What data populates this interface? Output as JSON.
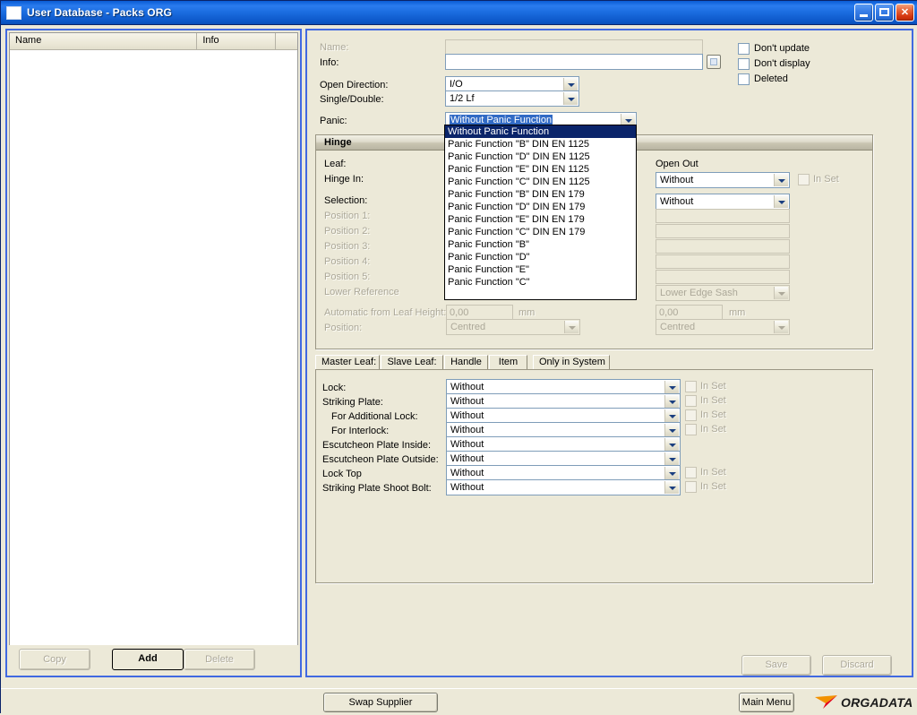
{
  "window": {
    "title": "User Database - Packs ORG",
    "buttons": {
      "minimize": "minimize",
      "maximize": "maximize",
      "close": "close"
    }
  },
  "left_panel": {
    "columns": [
      "Name",
      "Info",
      ""
    ],
    "rows": [],
    "buttons": {
      "copy": "Copy",
      "add": "Add",
      "delete": "Delete"
    }
  },
  "form": {
    "name_label": "Name:",
    "name_value": "",
    "info_label": "Info:",
    "info_value": "",
    "open_direction_label": "Open Direction:",
    "open_direction_value": "I/O",
    "single_double_label": "Single/Double:",
    "single_double_value": "1/2 Lf",
    "panic_label": "Panic:",
    "panic_value": "Without Panic Function",
    "checkboxes": [
      {
        "label": "Don't update",
        "checked": false
      },
      {
        "label": "Don't display",
        "checked": false
      },
      {
        "label": "Deleted",
        "checked": false
      }
    ]
  },
  "panic_dropdown": {
    "open": true,
    "selected_index": 0,
    "options": [
      "Without Panic Function",
      "Panic Function \"B\" DIN EN 1125",
      "Panic Function \"D\" DIN EN 1125",
      "Panic Function \"E\" DIN EN 1125",
      "Panic Function \"C\" DIN EN 1125",
      "Panic Function \"B\" DIN EN 179",
      "Panic Function \"D\" DIN EN 179",
      "Panic Function \"E\" DIN EN 179",
      "Panic Function \"C\" DIN EN 179",
      "Panic Function \"B\"",
      "Panic Function \"D\"",
      "Panic Function \"E\"",
      "Panic Function \"C\""
    ]
  },
  "hinge_group": {
    "title": "Hinge",
    "left_labels": [
      {
        "text": "Leaf:",
        "disabled": false
      },
      {
        "text": "Hinge In:",
        "disabled": false
      },
      {
        "text": "Selection:",
        "disabled": false
      },
      {
        "text": "Position 1:",
        "disabled": true
      },
      {
        "text": "Position 2:",
        "disabled": true
      },
      {
        "text": "Position 3:",
        "disabled": true
      },
      {
        "text": "Position 4:",
        "disabled": true
      },
      {
        "text": "Position 5:",
        "disabled": true
      },
      {
        "text": "Lower Reference",
        "disabled": true
      },
      {
        "text": "Automatic from Leaf Height:",
        "disabled": true
      },
      {
        "text": "Position:",
        "disabled": true
      }
    ],
    "auto_height_value": "0,00",
    "auto_height_unit": "mm",
    "position_value": "Centred",
    "open_out_label": "Open Out",
    "open_out_value": "Without",
    "open_out_inset_label": "In Set",
    "second_combo_value": "Without",
    "empty_fields": [
      "",
      "",
      "",
      "",
      ""
    ],
    "lower_ref_value": "Lower Edge Sash",
    "right_height_value": "0,00",
    "right_height_unit": "mm",
    "right_position_value": "Centred"
  },
  "tabs": [
    {
      "label": "Master Leaf:",
      "active": true
    },
    {
      "label": "Slave Leaf:",
      "active": false
    },
    {
      "label": "Handle",
      "active": false
    },
    {
      "label": "Item",
      "active": false
    },
    {
      "label": "Only in System",
      "active": false
    }
  ],
  "master_leaf": {
    "inset_label": "In Set",
    "rows": [
      {
        "label": "Lock:",
        "value": "Without",
        "indent": false,
        "has_inset": true
      },
      {
        "label": "Striking Plate:",
        "value": "Without",
        "indent": false,
        "has_inset": true
      },
      {
        "label": "For Additional Lock:",
        "value": "Without",
        "indent": true,
        "has_inset": true
      },
      {
        "label": "For Interlock:",
        "value": "Without",
        "indent": true,
        "has_inset": true
      },
      {
        "label": "Escutcheon Plate Inside:",
        "value": "Without",
        "indent": false,
        "has_inset": false
      },
      {
        "label": "Escutcheon Plate Outside:",
        "value": "Without",
        "indent": false,
        "has_inset": false
      },
      {
        "label": "Lock Top",
        "value": "Without",
        "indent": false,
        "has_inset": true
      },
      {
        "label": "Striking Plate Shoot Bolt:",
        "value": "Without",
        "indent": false,
        "has_inset": true
      }
    ]
  },
  "actions": {
    "save": "Save",
    "discard": "Discard"
  },
  "statusbar": {
    "swap_supplier": "Swap Supplier",
    "main_menu": "Main Menu",
    "logo_text": "ORGADATA"
  },
  "colors": {
    "title_bar": "#0A5BD3",
    "panel_border": "#4169E1",
    "face": "#ECE9D8",
    "highlight": "#0A246A",
    "disabled_text": "#ACA899",
    "logo_orange": "#F39200",
    "logo_red": "#E2001A"
  }
}
